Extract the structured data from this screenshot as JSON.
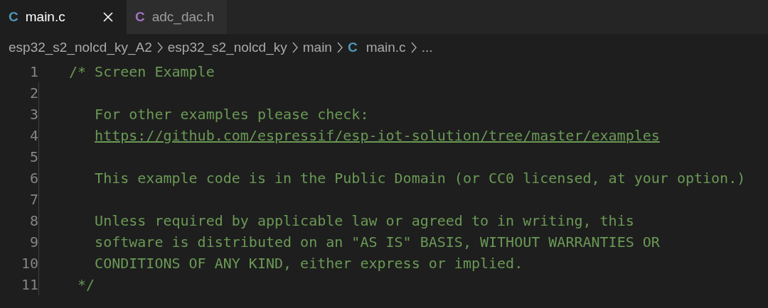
{
  "tabs": [
    {
      "icon": "C",
      "color": "#519aba",
      "label": "main.c",
      "selected": true
    },
    {
      "icon": "C",
      "color": "#a074c4",
      "label": "adc_dac.h",
      "selected": false
    }
  ],
  "breadcrumb": [
    {
      "label": "esp32_s2_nolcd_ky_A2"
    },
    {
      "label": "esp32_s2_nolcd_ky"
    },
    {
      "label": "main"
    },
    {
      "icon": "C",
      "label": "main.c"
    },
    {
      "label": "..."
    }
  ],
  "editor": {
    "lines": [
      {
        "number": "1",
        "kind": "comment",
        "text": "/* Screen Example"
      },
      {
        "number": "2"
      },
      {
        "number": "3",
        "kind": "comment",
        "text": "   For other examples please check:"
      },
      {
        "number": "4",
        "kind": "link",
        "text": "https://github.com/espressif/esp-iot-solution/tree/master/examples"
      },
      {
        "number": "5"
      },
      {
        "number": "6",
        "kind": "comment",
        "text": "   This example code is in the Public Domain (or CC0 licensed, at your option.)"
      },
      {
        "number": "7"
      },
      {
        "number": "8",
        "kind": "comment",
        "text": "   Unless required by applicable law or agreed to in writing, this"
      },
      {
        "number": "9",
        "kind": "comment",
        "text": "   software is distributed on an \"AS IS\" BASIS, WITHOUT WARRANTIES OR"
      },
      {
        "number": "10",
        "kind": "comment",
        "text": "   CONDITIONS OF ANY KIND, either express or implied."
      },
      {
        "number": "11",
        "kind": "comment",
        "text": " */"
      }
    ]
  }
}
